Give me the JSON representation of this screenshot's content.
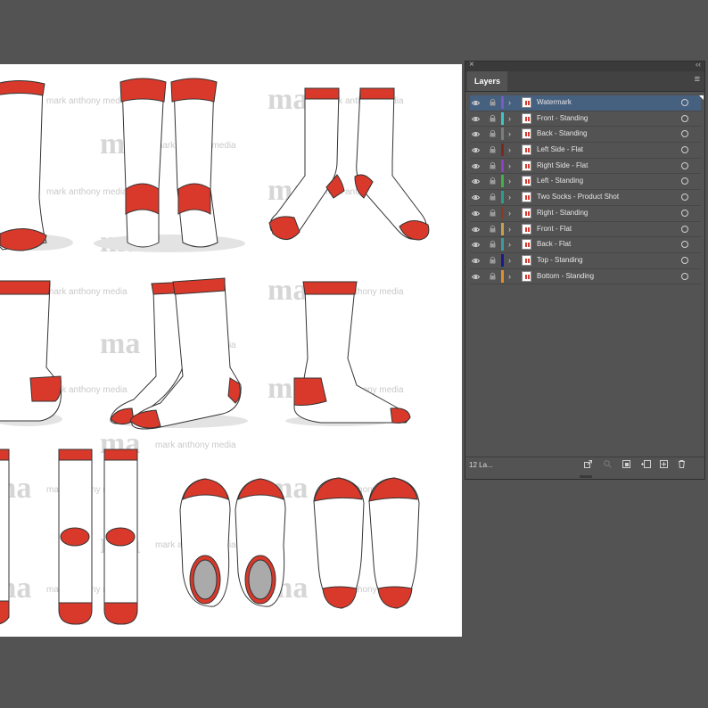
{
  "artboard": {
    "watermark_text": "mark anthony media",
    "watermark_mono": "ma",
    "colors": {
      "accent": "#d9392b",
      "outline": "#333333",
      "sock": "#ffffff",
      "shadow": "#e3e3e3",
      "heel_gray": "#aaaaaa"
    }
  },
  "layers_panel": {
    "tab_label": "Layers",
    "layer_count": "12 La...",
    "layers": [
      {
        "name": "Watermark",
        "color": "#7a5bc2",
        "selected": true
      },
      {
        "name": "Front - Standing",
        "color": "#3ec6c6",
        "selected": false
      },
      {
        "name": "Back - Standing",
        "color": "#7d7d7d",
        "selected": false
      },
      {
        "name": "Left Side - Flat",
        "color": "#7a2a1e",
        "selected": false
      },
      {
        "name": "Right Side - Flat",
        "color": "#8e3fc2",
        "selected": false
      },
      {
        "name": "Left - Standing",
        "color": "#3fb24a",
        "selected": false
      },
      {
        "name": "Two Socks - Product Shot",
        "color": "#2a9d8f",
        "selected": false
      },
      {
        "name": "Right - Standing",
        "color": "#8a3a2a",
        "selected": false
      },
      {
        "name": "Front - Flat",
        "color": "#c8a04a",
        "selected": false
      },
      {
        "name": "Back - Flat",
        "color": "#3a9d9d",
        "selected": false
      },
      {
        "name": "Top - Standing",
        "color": "#1a1a8e",
        "selected": false
      },
      {
        "name": "Bottom - Standing",
        "color": "#e0902a",
        "selected": false
      }
    ],
    "icons": {
      "close": "close-icon",
      "collapse": "collapse-icon",
      "menu": "panel-menu-icon",
      "visibility": "eye-icon",
      "lock": "lock-icon",
      "expand": "chevron-right-icon",
      "target": "target-circle-icon",
      "footer": [
        "export-icon",
        "locate-object-icon",
        "make-clipping-mask-icon",
        "create-sublayer-icon",
        "create-new-layer-icon",
        "delete-layer-icon"
      ]
    }
  }
}
